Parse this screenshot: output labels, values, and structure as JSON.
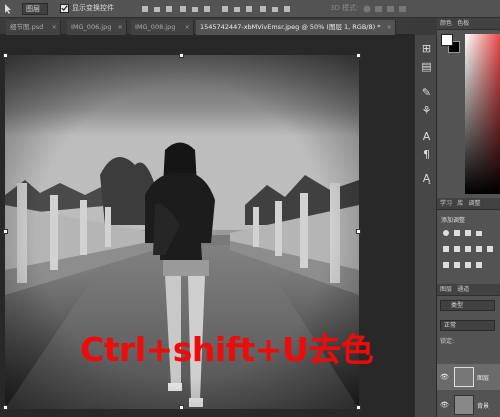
{
  "options_bar": {
    "auto_select_dropdown": "图层",
    "show_transform_controls": "显示变换控件",
    "mode_label": "3D 模式:"
  },
  "tabs": [
    {
      "label": "细节图.psd",
      "active": false
    },
    {
      "label": "IMG_006.jpg",
      "active": false
    },
    {
      "label": "IMG_008.jpg",
      "active": false
    },
    {
      "label": "1545742447-xbMVivEmsr.jpeg @ 50% (图层 1, RGB/8) *",
      "active": true
    }
  ],
  "overlay_caption": "Ctrl+shift+U去色",
  "panels": {
    "color_tab": "颜色",
    "swatches_tab": "色板",
    "learn_tab": "学习",
    "libraries_tab": "库",
    "adjustments_tab": "调整",
    "add_adjustment": "添加调整",
    "layers_tab": "图层",
    "channels_tab": "通道",
    "kind_filter": "类型",
    "blend_mode": "正常",
    "lock_label": "锁定:",
    "layer_1_name": "图层",
    "background_layer_name": "背景"
  },
  "colors": {
    "accent_red": "#f00a0a",
    "panel_bg": "#535353",
    "canvas_bg": "#282828"
  }
}
